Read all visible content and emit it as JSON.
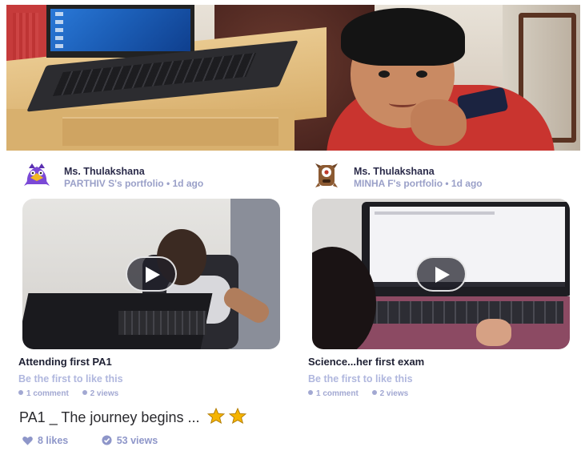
{
  "posts": [
    {
      "author": "Ms. Thulakshana",
      "meta": "PARTHIV S's portfolio • 1d ago",
      "caption": "Attending first PA1",
      "like_prompt": "Be the first to like this",
      "comments": "1 comment",
      "views": "2 views",
      "avatar_icon": "purple-monster-avatar-icon"
    },
    {
      "author": "Ms. Thulakshana",
      "meta": "MINHA F's portfolio • 1d ago",
      "caption": "Science...her first exam",
      "like_prompt": "Be the first to like this",
      "comments": "1 comment",
      "views": "2 views",
      "avatar_icon": "brown-cyclops-monster-avatar-icon"
    }
  ],
  "bottom_post": {
    "title": "PA1 _ The journey begins ...",
    "likes": "8 likes",
    "views": "53 views",
    "emoji": "star-emoji x2"
  },
  "colors": {
    "meta_text": "#9aa0c8",
    "stats_text": "#8e96c9",
    "star": "#f5b400"
  }
}
